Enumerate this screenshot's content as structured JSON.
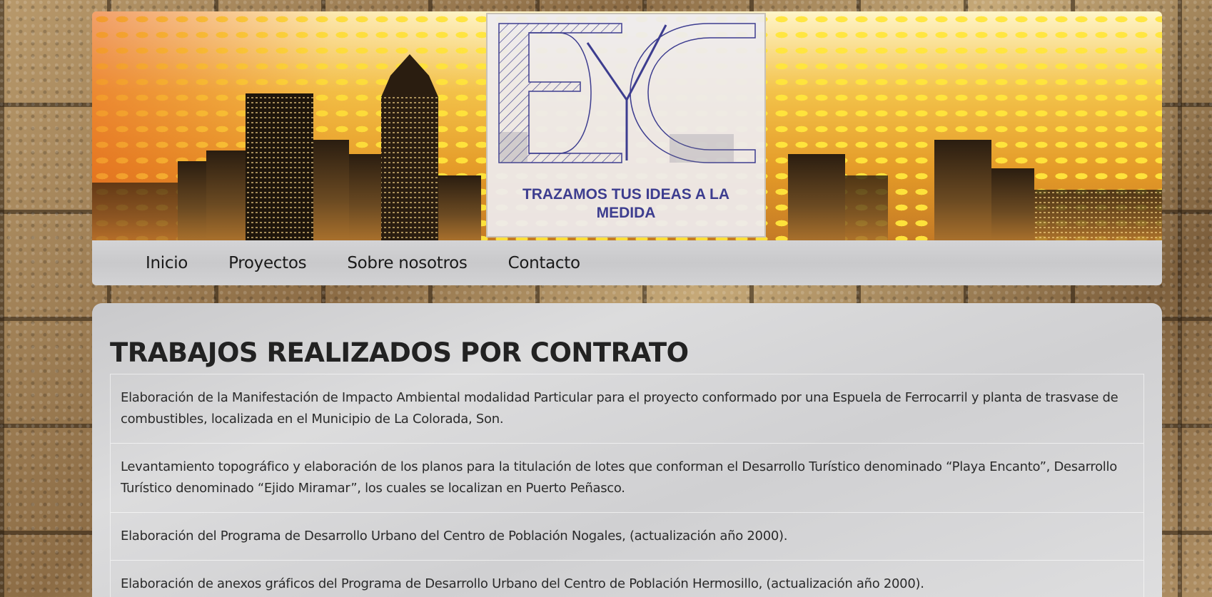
{
  "banner": {
    "tagline": "TRAZAMOS TUS IDEAS A LA MEDIDA",
    "colors": {
      "accent": "#3d3d8f",
      "sky_top": "#fff5c8",
      "sky_bottom": "#e49a27"
    }
  },
  "nav": {
    "items": [
      {
        "label": "Inicio"
      },
      {
        "label": "Proyectos"
      },
      {
        "label": "Sobre nosotros"
      },
      {
        "label": "Contacto"
      }
    ]
  },
  "main": {
    "title": "TRABAJOS REALIZADOS POR CONTRATO",
    "jobs": [
      "Elaboración de la Manifestación de Impacto Ambiental modalidad Particular para el proyecto conformado por una Espuela de Ferrocarril y planta de trasvase de combustibles, localizada en el Municipio de La Colorada, Son.",
      "Levantamiento topográfico y elaboración de los planos para la titulación de lotes que conforman el Desarrollo Turístico denominado “Playa Encanto”, Desarrollo Turístico denominado “Ejido Miramar”, los cuales se localizan en Puerto Peñasco.",
      "Elaboración del Programa de Desarrollo Urbano del Centro de Población Nogales, (actualización año 2000).",
      "Elaboración de anexos gráficos del Programa de Desarrollo Urbano del Centro de Población Hermosillo, (actualización año 2000)."
    ]
  }
}
